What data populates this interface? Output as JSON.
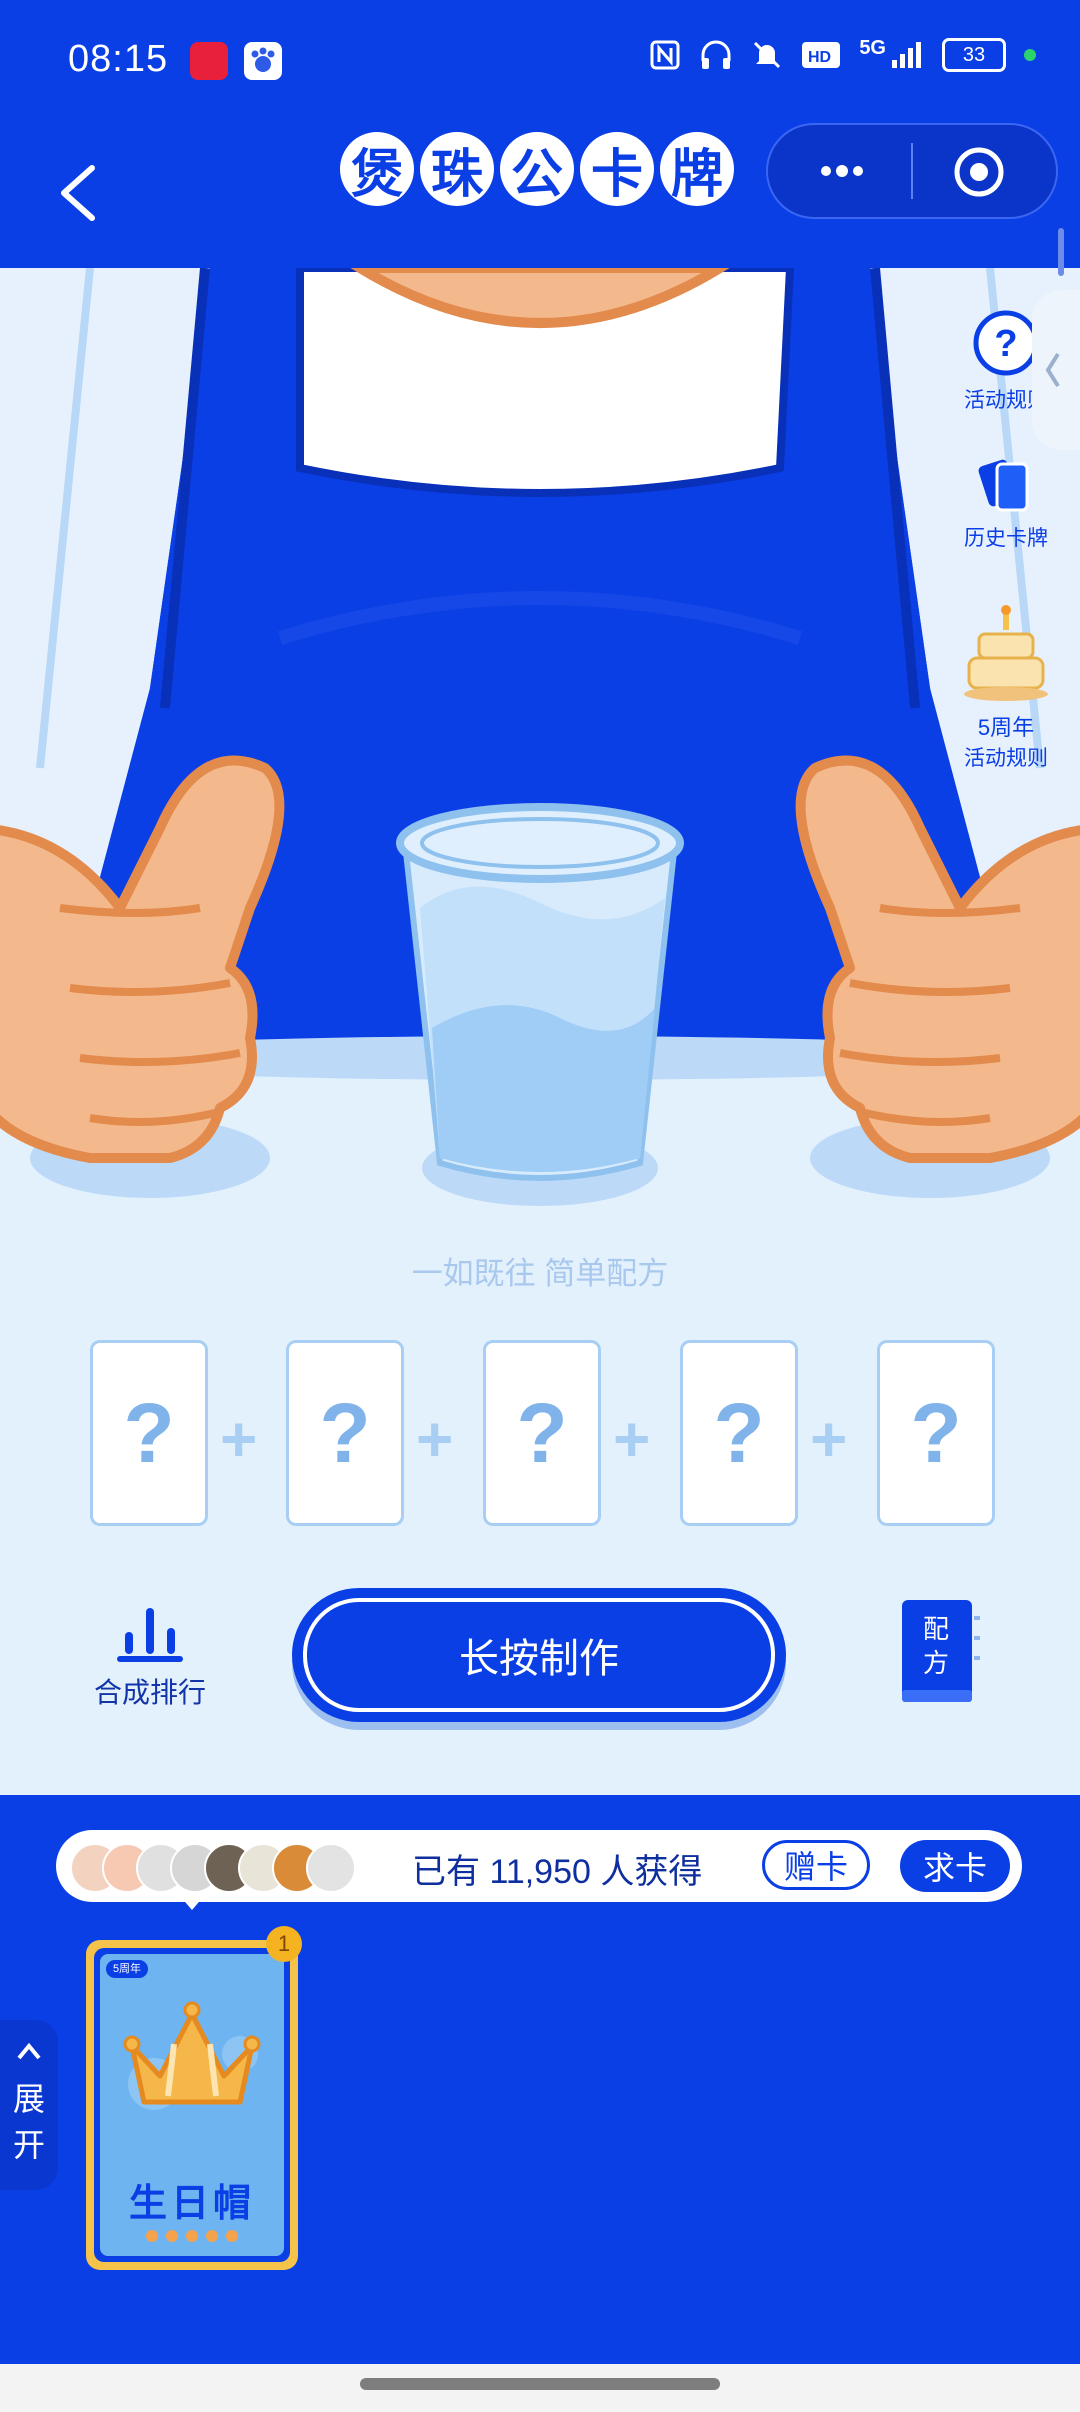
{
  "status_bar": {
    "time": "08:15",
    "network": "5G",
    "battery": "33"
  },
  "header": {
    "title_chars": [
      "煲",
      "珠",
      "公",
      "卡",
      "牌"
    ]
  },
  "side_menu": {
    "rules": "活动规则",
    "history": "历史卡牌",
    "anniversary_line1": "5周年",
    "anniversary_line2": "活动规则"
  },
  "formula": {
    "caption": "一如既往 简单配方",
    "slots": [
      "?",
      "?",
      "?",
      "?",
      "?"
    ],
    "plus": "+"
  },
  "actions": {
    "ranking_label": "合成排行",
    "make_label": "长按制作",
    "recipe_line1": "配",
    "recipe_line2": "方"
  },
  "holders": {
    "text": "已有 11,950 人获得",
    "gift_label": "赠卡",
    "ask_label": "求卡"
  },
  "card": {
    "tag": "5周年",
    "name": "生日帽",
    "count": "1"
  },
  "expand": {
    "line1": "展",
    "line2": "开"
  },
  "colors": {
    "brand_blue": "#0b3fe6",
    "light_bg": "#e3f1fd",
    "skin": "#f3b98c",
    "card_gold": "#f6c34a"
  }
}
